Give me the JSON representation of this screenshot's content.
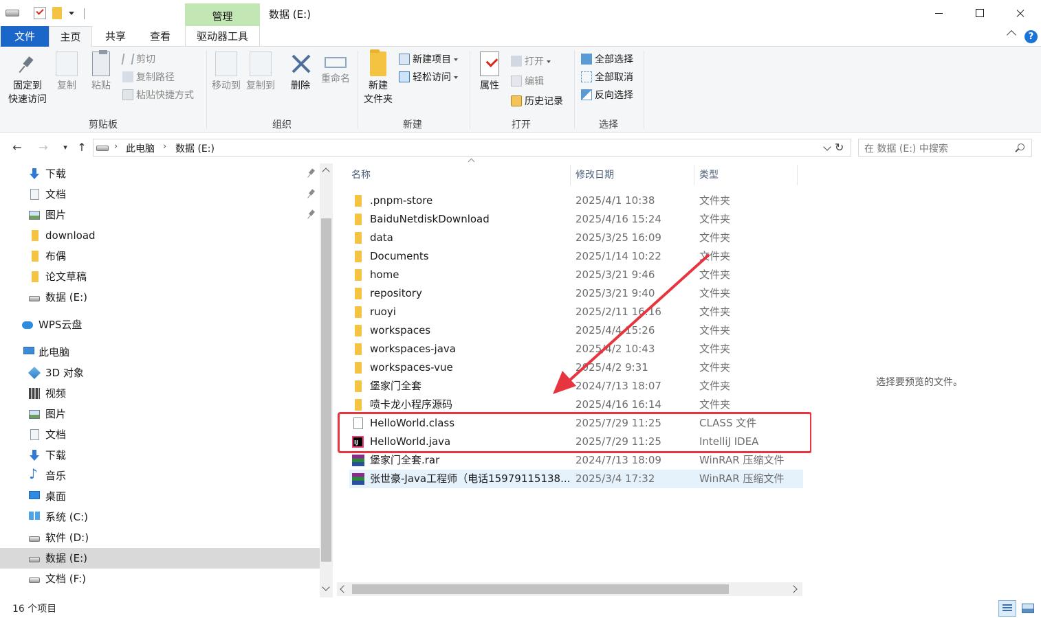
{
  "window": {
    "title": "数据 (E:)",
    "contextual_tab_group": "管理"
  },
  "ribbon": {
    "tabs": [
      "文件",
      "主页",
      "共享",
      "查看",
      "驱动器工具"
    ],
    "active_tab": "主页",
    "clipboard": {
      "label": "剪贴板",
      "pin_line1": "固定到",
      "pin_line2": "快速访问",
      "copy": "复制",
      "paste": "粘贴",
      "cut": "剪切",
      "copy_path": "复制路径",
      "paste_shortcut": "粘贴快捷方式"
    },
    "organize": {
      "label": "组织",
      "move_to": "移动到",
      "copy_to": "复制到",
      "delete": "删除",
      "rename": "重命名"
    },
    "new": {
      "label": "新建",
      "new_item": "新建项目",
      "easy_access": "轻松访问",
      "new_folder_line1": "新建",
      "new_folder_line2": "文件夹"
    },
    "open": {
      "label": "打开",
      "properties": "属性",
      "open": "打开",
      "edit": "编辑",
      "history": "历史记录"
    },
    "select": {
      "label": "选择",
      "select_all": "全部选择",
      "select_none": "全部取消",
      "invert": "反向选择"
    }
  },
  "address": {
    "crumbs": [
      "此电脑",
      "数据 (E:)"
    ],
    "search_placeholder": "在 数据 (E:) 中搜索"
  },
  "nav": {
    "items": [
      {
        "label": "下载",
        "icon": "download-icon",
        "pinned": true
      },
      {
        "label": "文档",
        "icon": "document-icon",
        "pinned": true
      },
      {
        "label": "图片",
        "icon": "picture-icon",
        "pinned": true
      },
      {
        "label": "download",
        "icon": "folder-icon",
        "pinned": false
      },
      {
        "label": "布偶",
        "icon": "folder-icon",
        "pinned": false
      },
      {
        "label": "论文草稿",
        "icon": "folder-icon",
        "pinned": false
      },
      {
        "label": "数据 (E:)",
        "icon": "drive-icon",
        "pinned": false
      },
      {
        "label": "WPS云盘",
        "icon": "cloud-icon",
        "pinned": false
      },
      {
        "label": "此电脑",
        "icon": "computer-icon",
        "pinned": false
      },
      {
        "label": "3D 对象",
        "icon": "3d-objects-icon",
        "pinned": false
      },
      {
        "label": "视频",
        "icon": "video-icon",
        "pinned": false
      },
      {
        "label": "图片",
        "icon": "picture-icon",
        "pinned": false
      },
      {
        "label": "文档",
        "icon": "document-icon",
        "pinned": false
      },
      {
        "label": "下载",
        "icon": "download-icon",
        "pinned": false
      },
      {
        "label": "音乐",
        "icon": "music-icon",
        "pinned": false
      },
      {
        "label": "桌面",
        "icon": "desktop-icon",
        "pinned": false
      },
      {
        "label": "系统 (C:)",
        "icon": "windows-drive-icon",
        "pinned": false
      },
      {
        "label": "软件 (D:)",
        "icon": "drive-icon",
        "pinned": false
      },
      {
        "label": "数据 (E:)",
        "icon": "drive-icon",
        "pinned": false,
        "selected": true
      },
      {
        "label": "文档 (F:)",
        "icon": "drive-icon",
        "pinned": false
      }
    ]
  },
  "files": {
    "columns": {
      "name": "名称",
      "date": "修改日期",
      "type": "类型"
    },
    "rows": [
      {
        "name": ".pnpm-store",
        "date": "2025/4/1 10:38",
        "type": "文件夹",
        "icon": "folder-icon"
      },
      {
        "name": "BaiduNetdiskDownload",
        "date": "2025/4/16 15:24",
        "type": "文件夹",
        "icon": "folder-icon"
      },
      {
        "name": "data",
        "date": "2025/3/25 16:09",
        "type": "文件夹",
        "icon": "folder-icon"
      },
      {
        "name": "Documents",
        "date": "2025/1/14 10:22",
        "type": "文件夹",
        "icon": "folder-icon"
      },
      {
        "name": "home",
        "date": "2025/3/21 9:46",
        "type": "文件夹",
        "icon": "folder-icon"
      },
      {
        "name": "repository",
        "date": "2025/3/21 9:40",
        "type": "文件夹",
        "icon": "folder-icon"
      },
      {
        "name": "ruoyi",
        "date": "2025/2/11 16:16",
        "type": "文件夹",
        "icon": "folder-icon"
      },
      {
        "name": "workspaces",
        "date": "2025/4/4 15:26",
        "type": "文件夹",
        "icon": "folder-icon"
      },
      {
        "name": "workspaces-java",
        "date": "2025/4/2 10:43",
        "type": "文件夹",
        "icon": "folder-icon"
      },
      {
        "name": "workspaces-vue",
        "date": "2025/4/2 9:31",
        "type": "文件夹",
        "icon": "folder-icon"
      },
      {
        "name": "堡家门全套",
        "date": "2024/7/13 18:07",
        "type": "文件夹",
        "icon": "folder-icon"
      },
      {
        "name": "喷卡龙小程序源码",
        "date": "2025/4/16 16:14",
        "type": "文件夹",
        "icon": "folder-icon"
      },
      {
        "name": "HelloWorld.class",
        "date": "2025/7/29 11:25",
        "type": "CLASS 文件",
        "icon": "file-icon"
      },
      {
        "name": "HelloWorld.java",
        "date": "2025/7/29 11:25",
        "type": "IntelliJ IDEA",
        "icon": "intellij-icon"
      },
      {
        "name": "堡家门全套.rar",
        "date": "2024/7/13 18:09",
        "type": "WinRAR 压缩文件",
        "icon": "winrar-icon"
      },
      {
        "name": "张世豪-Java工程师（电话15979115138...",
        "date": "2025/3/4 17:32",
        "type": "WinRAR 压缩文件",
        "icon": "winrar-icon",
        "highlighted": true
      }
    ]
  },
  "preview": {
    "empty_text": "选择要预览的文件。"
  },
  "status": {
    "item_count": "16 个项目"
  },
  "annotation": {
    "color": "#e7353f"
  }
}
